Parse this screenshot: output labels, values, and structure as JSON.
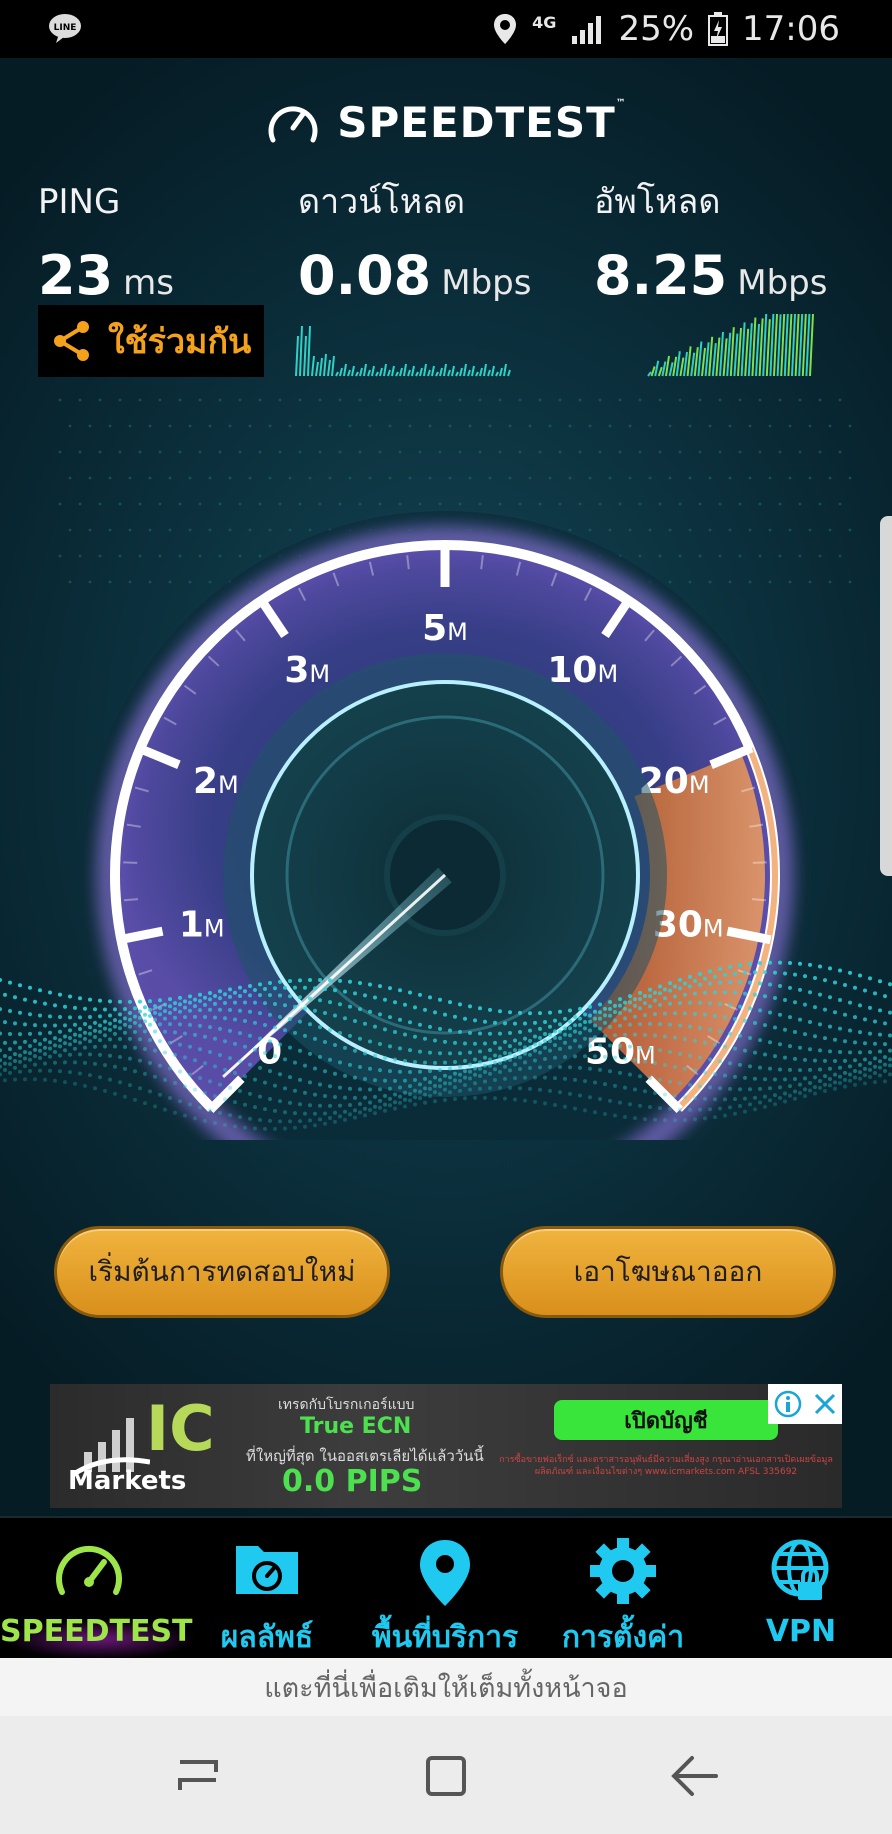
{
  "status_bar": {
    "network": "4G",
    "battery": "25%",
    "time": "17:06",
    "icons": [
      "line-icon",
      "location-icon",
      "4g-data-icon",
      "signal-icon",
      "battery-charging-icon"
    ]
  },
  "header": {
    "title": "SPEEDTEST",
    "trademark": "™"
  },
  "stats": {
    "ping": {
      "label": "PING",
      "value": "23",
      "unit": "ms"
    },
    "download": {
      "label": "ดาวน์โหลด",
      "value": "0.08",
      "unit": "Mbps"
    },
    "upload": {
      "label": "อัพโหลด",
      "value": "8.25",
      "unit": "Mbps"
    }
  },
  "share_button": {
    "label": "ใช้ร่วมกัน",
    "icon": "share-icon"
  },
  "gauge": {
    "ticks": [
      {
        "value": "0",
        "suffix": ""
      },
      {
        "value": "1",
        "suffix": "M"
      },
      {
        "value": "2",
        "suffix": "M"
      },
      {
        "value": "3",
        "suffix": "M"
      },
      {
        "value": "5",
        "suffix": "M"
      },
      {
        "value": "10",
        "suffix": "M"
      },
      {
        "value": "20",
        "suffix": "M"
      },
      {
        "value": "30",
        "suffix": "M"
      },
      {
        "value": "50",
        "suffix": "M"
      }
    ],
    "needle_value_mbps": 0.08,
    "colors": {
      "ring": "#ffffff",
      "glow": "#a884ff",
      "upload_arc": "#e8833a",
      "needle": "#9ff3ff"
    }
  },
  "buttons": {
    "restart_label": "เริ่มต้นการทดสอบใหม่",
    "remove_ads_label": "เอาโฆษณาออก"
  },
  "ad": {
    "brand_ic": "IC",
    "brand_markets": "Markets",
    "line1": "เทรดกับโบรกเกอร์แบบ",
    "line2": "True ECN",
    "line3": "ที่ใหญ่ที่สุด ในออสเตรเลียได้แล้ววันนี้",
    "line4": "0.0 PIPS",
    "cta": "เปิดบัญชี",
    "fine_print": "การซื้อขายฟอเร็กซ์ และตราสารอนุพันธ์มีความเสี่ยงสูง กรุณาอ่านเอกสารเปิดเผยข้อมูลผลิตภัณฑ์ และเงื่อนไขต่างๆ www.icmarkets.com AFSL 335692"
  },
  "bottom_nav": {
    "items": [
      {
        "label": "SPEEDTEST",
        "icon": "speedometer-icon",
        "active": true
      },
      {
        "label": "ผลลัพธ์",
        "icon": "results-folder-icon",
        "active": false
      },
      {
        "label": "พื้นที่บริการ",
        "icon": "map-pin-icon",
        "active": false
      },
      {
        "label": "การตั้งค่า",
        "icon": "gear-icon",
        "active": false
      },
      {
        "label": "VPN",
        "icon": "vpn-globe-lock-icon",
        "active": false
      }
    ]
  },
  "fullscreen_hint": "แตะที่นี่เพื่อเติมให้เต็มทั้งหน้าจอ",
  "colors": {
    "accent_orange": "#f4a21b",
    "nav_blue": "#1fc9f0",
    "nav_active_green": "#9ee54a",
    "button_gold": "#e6a22c"
  }
}
